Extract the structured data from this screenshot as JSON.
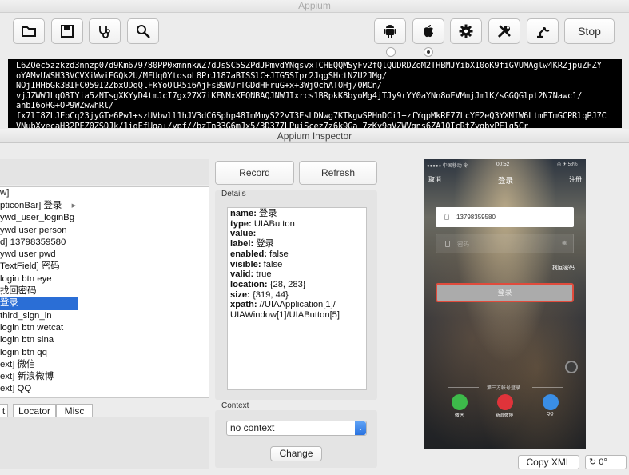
{
  "appium": {
    "title": "Appium",
    "toolbar": {
      "icons": [
        "folder-icon",
        "save-icon",
        "stethoscope-icon",
        "inspector-icon",
        "android-icon",
        "apple-icon",
        "gear-icon",
        "wrench-icon",
        "robot-icon"
      ],
      "stop_label": "Stop"
    },
    "log_lines": [
      "L6ZOec5zzkzd3nnzp07d9Km679780PP0xmnnkWZ7dJsSC5SZPdJPmvdYNqsvxTCHEQQMSyFv2fQlQUDRDZoM2THBMJYibX10oK9fiGVUMAglw4KRZjpuZFZY",
      "oYAMvUWSH33VCVXiWwiEGQk2U/MFUq0YtosoL8PrJ187aBISSlC+JTG5SIpr2JqgSHctNZU2JMg/",
      "NOjIHHbGk3BIFC059I2ZbxUDqQlFkYoOlR5i6AjFsB9WJrTGDdHFruG+x+3Wj0chATOHj/0MCn/",
      "vjJZWWJLqO8IYia5zNTsgXKYyD4tmJcI7gx27X7iKFNMxXEQNBAQJNWJIxrcs1BRpkK8byoMg4jTJy9rYY0aYNn8oEVMmjJmlK/sGGQGlpt2N7Nawc1/",
      "anbI6oHG+OP9WZwwhRl/",
      "fx7lI8ZLJEbCq23jyGTe6Pw1+szUVbwll1hJV3dC6Sphp48ImMmyS22vT3EsLDNwg7KTkgwSPHnDCi1+zfYqpMkRE77LcYE2eQ3YXMIW6LtmFTmGCPRlqPJ7C",
      "VNubXyecaH32PFZ0ZSQJk/1igEfUga+/ypf//bzTn33G6mJx5/3D377LPuiScez7z6k9Ga+7zKy9qVZWVqns6ZA1OIcRtZygbyPElq5Cr"
    ]
  },
  "inspector": {
    "title": "Appium Inspector",
    "tree": {
      "header": "w]",
      "items": [
        {
          "label": "pticonBar] 登录",
          "has_arrow": true
        },
        {
          "label": "ywd_user_loginBg"
        },
        {
          "label": " ywd user person"
        },
        {
          "label": "d] 13798359580"
        },
        {
          "label": " ywd user pwd"
        },
        {
          "label": "TextField] 密码"
        },
        {
          "label": " login btn eye"
        },
        {
          "label": " 找回密码"
        },
        {
          "label": " 登录",
          "selected": true
        },
        {
          "label": " third_sign_in"
        },
        {
          "label": " login btn wetcat"
        },
        {
          "label": " login btn sina"
        },
        {
          "label": " login btn qq"
        },
        {
          "label": "ext] 微信"
        },
        {
          "label": "ext] 新浪微博"
        },
        {
          "label": "ext] QQ"
        }
      ]
    },
    "bottom_tabs": [
      "t",
      "Locator",
      "Misc"
    ],
    "record_label": "Record",
    "refresh_label": "Refresh",
    "details": {
      "title": "Details",
      "fields": [
        {
          "key": "name:",
          "value": " 登录"
        },
        {
          "key": "type:",
          "value": " UIAButton"
        },
        {
          "key": "value:",
          "value": ""
        },
        {
          "key": "label:",
          "value": " 登录"
        },
        {
          "key": "enabled:",
          "value": " false"
        },
        {
          "key": "visible:",
          "value": " false"
        },
        {
          "key": "valid:",
          "value": " true"
        },
        {
          "key": "location:",
          "value": " {28, 283}"
        },
        {
          "key": "size:",
          "value": " {319, 44}"
        },
        {
          "key": "xpath:",
          "value": " //UIAApplication[1]/"
        }
      ],
      "xpath_cont": "UIAWindow[1]/UIAButton[5]"
    },
    "context": {
      "title": "Context",
      "selected": "no context",
      "change_label": "Change"
    },
    "copy_xml_label": "Copy XML",
    "rotate_label": "0°"
  },
  "phone": {
    "status_left": "●●●●○ 中国移动 令",
    "time": "00:52",
    "status_right": "◎ ✈ 58%",
    "cancel": "取消",
    "title": "登录",
    "register": "注册",
    "username": "13798359580",
    "password_placeholder": "密码",
    "forgot": "找回密码",
    "login": "登录",
    "third_party": "第三方帐号登录",
    "social": [
      "微信",
      "新浪微博",
      "QQ"
    ],
    "social_colors": [
      "#3dba4a",
      "#e0333a",
      "#3a8ee6"
    ]
  }
}
